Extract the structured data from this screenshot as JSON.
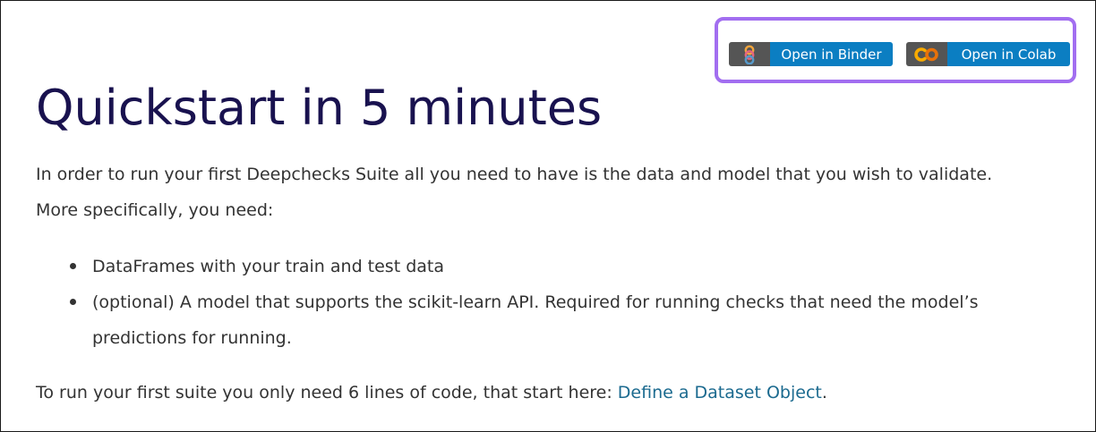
{
  "badges": {
    "binder": {
      "label": "Open in Binder",
      "icon": "binder-logo-icon"
    },
    "colab": {
      "label": "Open in Colab",
      "icon": "colab-logo-icon"
    }
  },
  "colors": {
    "title": "#19124f",
    "text": "#333333",
    "link": "#1b6a8f",
    "badge_left": "#555555",
    "badge_right": "#0b7ec2",
    "highlight": "#a26ef0"
  },
  "content": {
    "title": "Quickstart in 5 minutes",
    "intro_line1": "In order to run your first Deepchecks Suite all you need to have is the data and model that you wish to validate.",
    "intro_line2": "More specifically, you need:",
    "bullets": [
      {
        "text": "DataFrames with your train and test data"
      },
      {
        "line1": "(optional) A model that supports the scikit-learn API. Required for running checks that need the model’s",
        "line2": "predictions for running."
      }
    ],
    "footer_text": "To run your first suite you only need 6 lines of code, that start here: ",
    "footer_link": "Define a Dataset Object",
    "footer_end": "."
  }
}
